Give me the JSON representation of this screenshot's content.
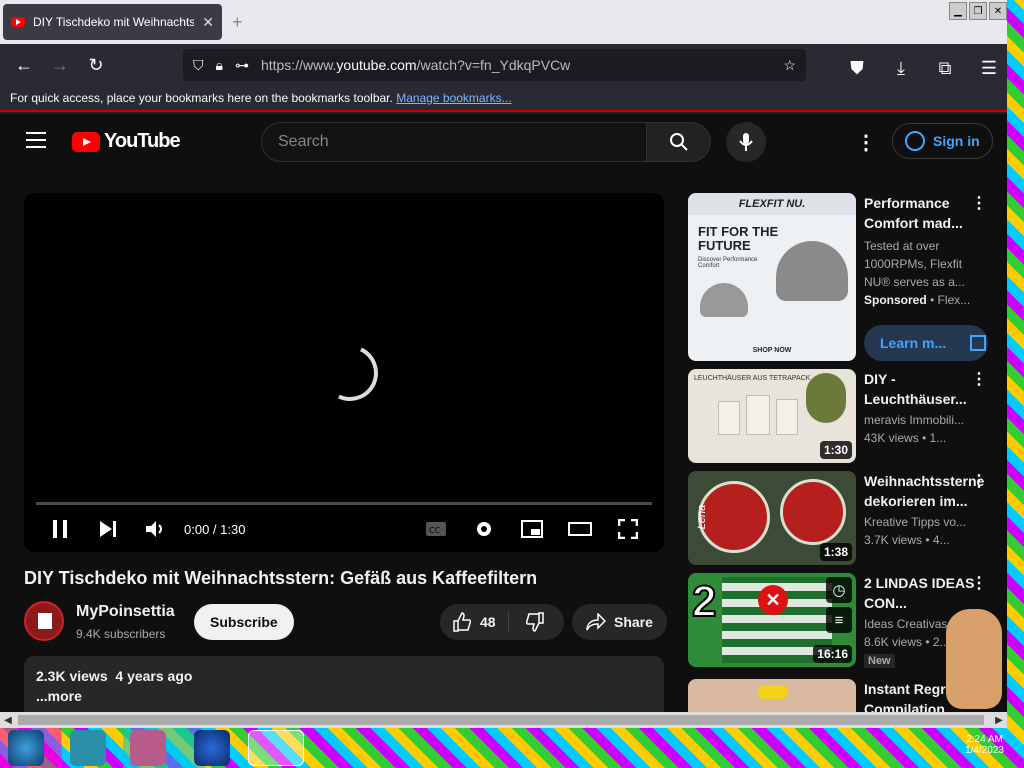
{
  "browser": {
    "tab_title": "DIY Tischdeko mit Weihnachtsstern",
    "url_prefix": "https://www.",
    "url_domain": "youtube.com",
    "url_path": "/watch?v=fn_YdkqPVCw",
    "bookmarks_text": "For quick access, place your bookmarks here on the bookmarks toolbar.",
    "bookmarks_link": "Manage bookmarks..."
  },
  "youtube": {
    "logo_text": "YouTube",
    "search_placeholder": "Search",
    "sign_in": "Sign in"
  },
  "player": {
    "time": "0:00 / 1:30"
  },
  "video": {
    "title": "DIY Tischdeko mit Weihnachtsstern: Gefäß aus Kaffeefiltern",
    "channel": "MyPoinsettia",
    "subscribers": "9.4K subscribers",
    "subscribe_label": "Subscribe",
    "likes": "48",
    "share_label": "Share",
    "views": "2.3K views",
    "age": "4 years ago",
    "more": "...more"
  },
  "sidebar": {
    "ad": {
      "title": "Performance Comfort mad...",
      "desc1": "Tested at over",
      "desc2": "1000RPMs, Flexfit",
      "desc3": "NU® serves as a...",
      "sponsored": "Sponsored",
      "sponsor_name": " • Flex...",
      "learn_more": "Learn m...",
      "brand": "FLEXFIT NU.",
      "headline": "FIT FOR THE FUTURE",
      "sub": "Discover Performance Comfort",
      "shop": "SHOP NOW"
    },
    "videos": [
      {
        "title": "DIY - Leuchthäuser...",
        "channel": "meravis Immobili...",
        "stats": "43K views • 1...",
        "duration": "1:30",
        "thumb_text": "LEUCHTHÄUSER AUS TETRAPACK"
      },
      {
        "title": "Weihnachtssterne dekorieren im...",
        "channel": "Kreative Tipps vo...",
        "stats": "3.7K views • 4...",
        "duration": "1:38",
        "thumb_text": "Lena"
      },
      {
        "title": "2 LINDAS IDEAS CON...",
        "channel": "Ideas Creativas",
        "stats": "8.6K views • 2...",
        "duration": "16:16",
        "badge": "New",
        "thumb_text": "2"
      },
      {
        "title": "Instant Regret Compilation",
        "channel": "",
        "stats": "",
        "duration": ""
      }
    ]
  },
  "taskbar": {
    "clock_time": "2:24 AM",
    "clock_date": "1/4/2023"
  }
}
